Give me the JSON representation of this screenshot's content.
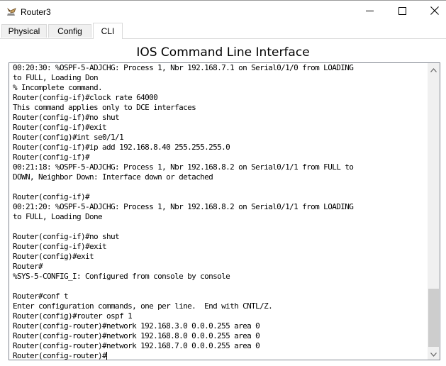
{
  "window": {
    "title": "Router3"
  },
  "tabs": [
    {
      "label": "Physical"
    },
    {
      "label": "Config"
    },
    {
      "label": "CLI",
      "active": true
    }
  ],
  "heading": "IOS Command Line Interface",
  "terminal": {
    "lines": [
      "00:20:30: %OSPF-5-ADJCHG: Process 1, Nbr 192.168.7.1 on Serial0/1/0 from LOADING",
      "to FULL, Loading Don",
      "% Incomplete command.",
      "Router(config-if)#clock rate 64000",
      "This command applies only to DCE interfaces",
      "Router(config-if)#no shut",
      "Router(config-if)#exit",
      "Router(config)#int se0/1/1",
      "Router(config-if)#ip add 192.168.8.40 255.255.255.0",
      "Router(config-if)#",
      "00:21:18: %OSPF-5-ADJCHG: Process 1, Nbr 192.168.8.2 on Serial0/1/1 from FULL to",
      "DOWN, Neighbor Down: Interface down or detached",
      "",
      "Router(config-if)#",
      "00:21:20: %OSPF-5-ADJCHG: Process 1, Nbr 192.168.8.2 on Serial0/1/1 from LOADING",
      "to FULL, Loading Done",
      "",
      "Router(config-if)#no shut",
      "Router(config-if)#exit",
      "Router(config)#exit",
      "Router#",
      "%SYS-5-CONFIG_I: Configured from console by console",
      "",
      "Router#conf t",
      "Enter configuration commands, one per line.  End with CNTL/Z.",
      "Router(config)#router ospf 1",
      "Router(config-router)#network 192.168.3.0 0.0.0.255 area 0",
      "Router(config-router)#network 192.168.8.0 0.0.0.255 area 0",
      "Router(config-router)#network 192.168.7.0 0.0.0.255 area 0",
      "Router(config-router)#"
    ]
  },
  "icons": {
    "app": "router-app-icon",
    "minimize": "minimize-icon",
    "maximize": "maximize-icon",
    "close": "close-icon",
    "scroll_up": "chevron-up-icon",
    "scroll_down": "chevron-down-icon"
  }
}
